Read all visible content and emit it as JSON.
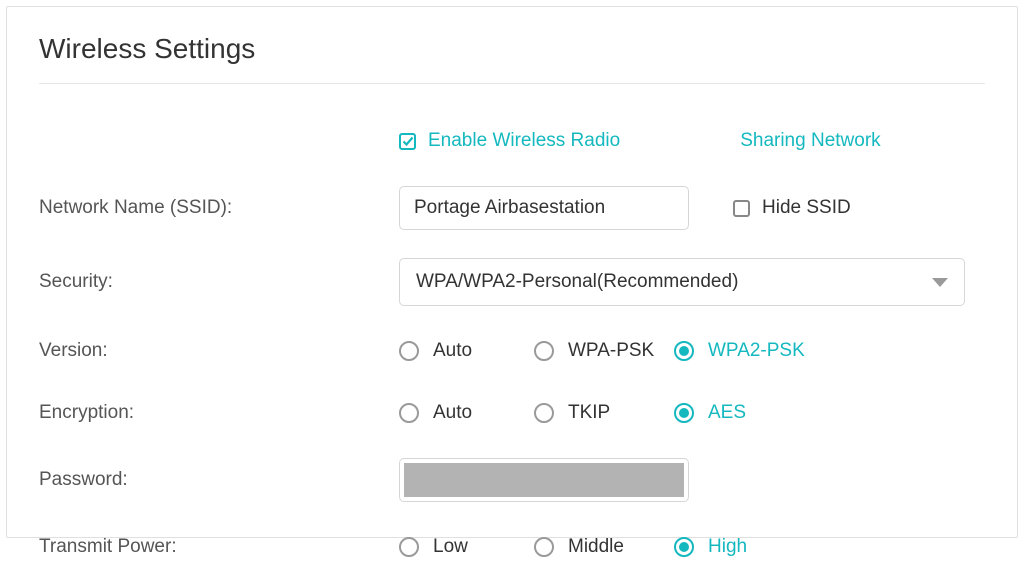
{
  "title": "Wireless Settings",
  "enable_wireless": {
    "label": "Enable Wireless Radio",
    "checked": true
  },
  "sharing_link": "Sharing Network",
  "ssid": {
    "label": "Network Name (SSID):",
    "value": "Portage Airbasestation"
  },
  "hide_ssid": {
    "label": "Hide SSID",
    "checked": false
  },
  "security": {
    "label": "Security:",
    "selected": "WPA/WPA2-Personal(Recommended)"
  },
  "version": {
    "label": "Version:",
    "options": [
      {
        "label": "Auto",
        "selected": false
      },
      {
        "label": "WPA-PSK",
        "selected": false
      },
      {
        "label": "WPA2-PSK",
        "selected": true
      }
    ]
  },
  "encryption": {
    "label": "Encryption:",
    "options": [
      {
        "label": "Auto",
        "selected": false
      },
      {
        "label": "TKIP",
        "selected": false
      },
      {
        "label": "AES",
        "selected": true
      }
    ]
  },
  "password": {
    "label": "Password:",
    "value": ""
  },
  "transmit_power": {
    "label": "Transmit Power:",
    "options": [
      {
        "label": "Low",
        "selected": false
      },
      {
        "label": "Middle",
        "selected": false
      },
      {
        "label": "High",
        "selected": true
      }
    ]
  }
}
